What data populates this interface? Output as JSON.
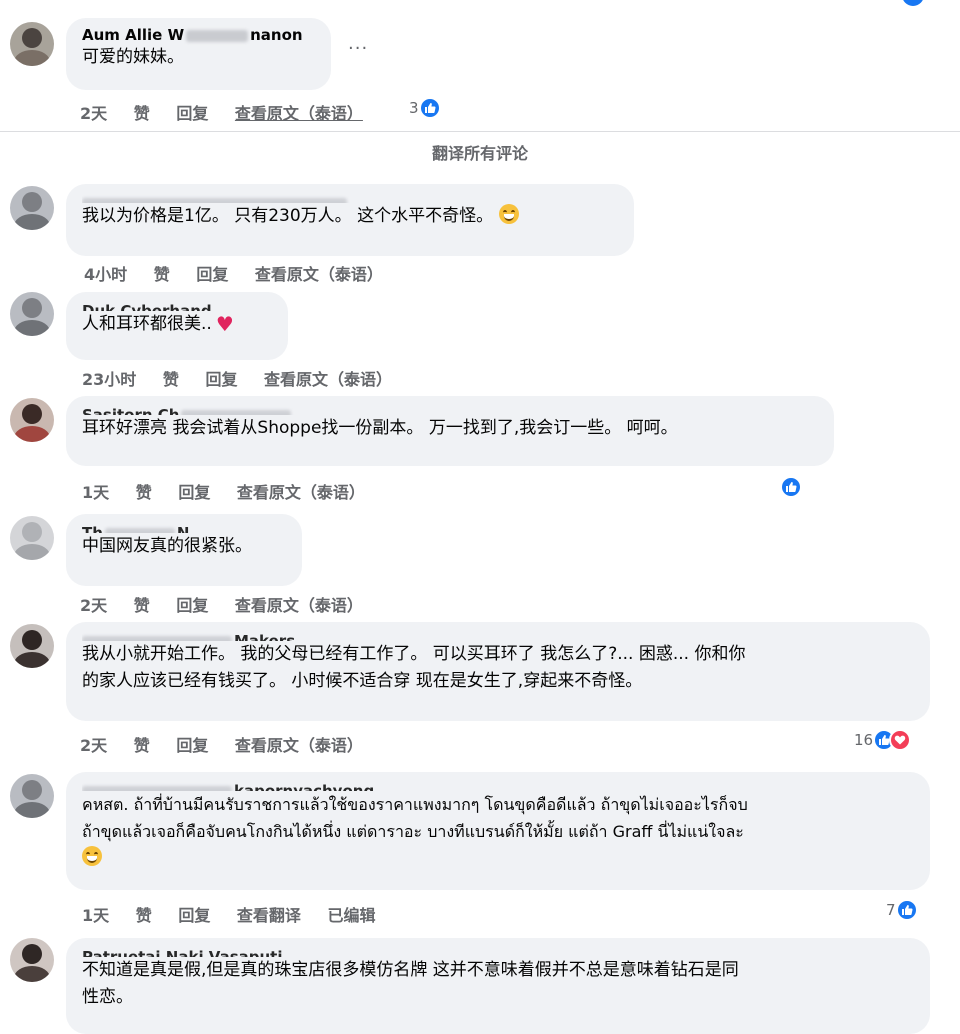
{
  "translate_all_label": "翻译所有评论",
  "comments": [
    {
      "author": "Aum Allie W",
      "author_tail": "nanon",
      "text": [
        "可爱的妹妹。"
      ],
      "time": "2天",
      "like": "赞",
      "reply": "回复",
      "view": "查看原文（泰语）",
      "reactions": "3"
    },
    {
      "author": "",
      "text": [
        "我以为价格是1亿。 只有230万人。 这个水平不奇怪。"
      ],
      "time": "4小时",
      "like": "赞",
      "reply": "回复",
      "view": "查看原文（泰语）"
    },
    {
      "author": "Duk Cyberhand",
      "text": [
        "人和耳环都很美.."
      ],
      "time": "23小时",
      "like": "赞",
      "reply": "回复",
      "view": "查看原文（泰语）"
    },
    {
      "author": "Sasitorn Ch",
      "text": [
        "耳环好漂亮 我会试着从Shoppe找一份副本。 万一找到了,我会订一些。 呵呵。"
      ],
      "time": "1天",
      "like": "赞",
      "reply": "回复",
      "view": "查看原文（泰语）"
    },
    {
      "author": "Th",
      "author_tail": "N",
      "text": [
        "中国网友真的很紧张。"
      ],
      "time": "2天",
      "like": "赞",
      "reply": "回复",
      "view": "查看原文（泰语）"
    },
    {
      "author": "",
      "author_tail": "Makers",
      "text": [
        "我从小就开始工作。 我的父母已经有工作了。 可以买耳环了 我怎么了?... 困惑... 你和你",
        "的家人应该已经有钱买了。 小时候不适合穿 现在是女生了,穿起来不奇怪。"
      ],
      "time": "2天",
      "like": "赞",
      "reply": "回复",
      "view": "查看原文（泰语）",
      "reactions": "16"
    },
    {
      "author": "",
      "author_tail": "kapornyachyong",
      "text": [
        "คหสต. ถ้าที่บ้านมีคนรับราชการแล้วใช้ของราคาแพงมากๆ โดนขุดคือดีแล้ว ถ้าขุดไม่เจออะไรก็จบ",
        "ถ้าขุดแล้วเจอก็คือจับคนโกงกินได้หนึ่ง แต่ดาราอะ บางทีแบรนด์ก็ให้มั้ย แต่ถ้า Graff นี่ไม่แน่ใจละ"
      ],
      "time": "1天",
      "like": "赞",
      "reply": "回复",
      "view": "查看翻译",
      "edited": "已编辑",
      "reactions": "7"
    },
    {
      "author": "Patruetai Naki Vasaputi",
      "text": [
        "不知道是真是假,但是真的珠宝店很多模仿名牌 这并不意味着假并不总是意味着钻石是同",
        "性恋。"
      ]
    }
  ]
}
